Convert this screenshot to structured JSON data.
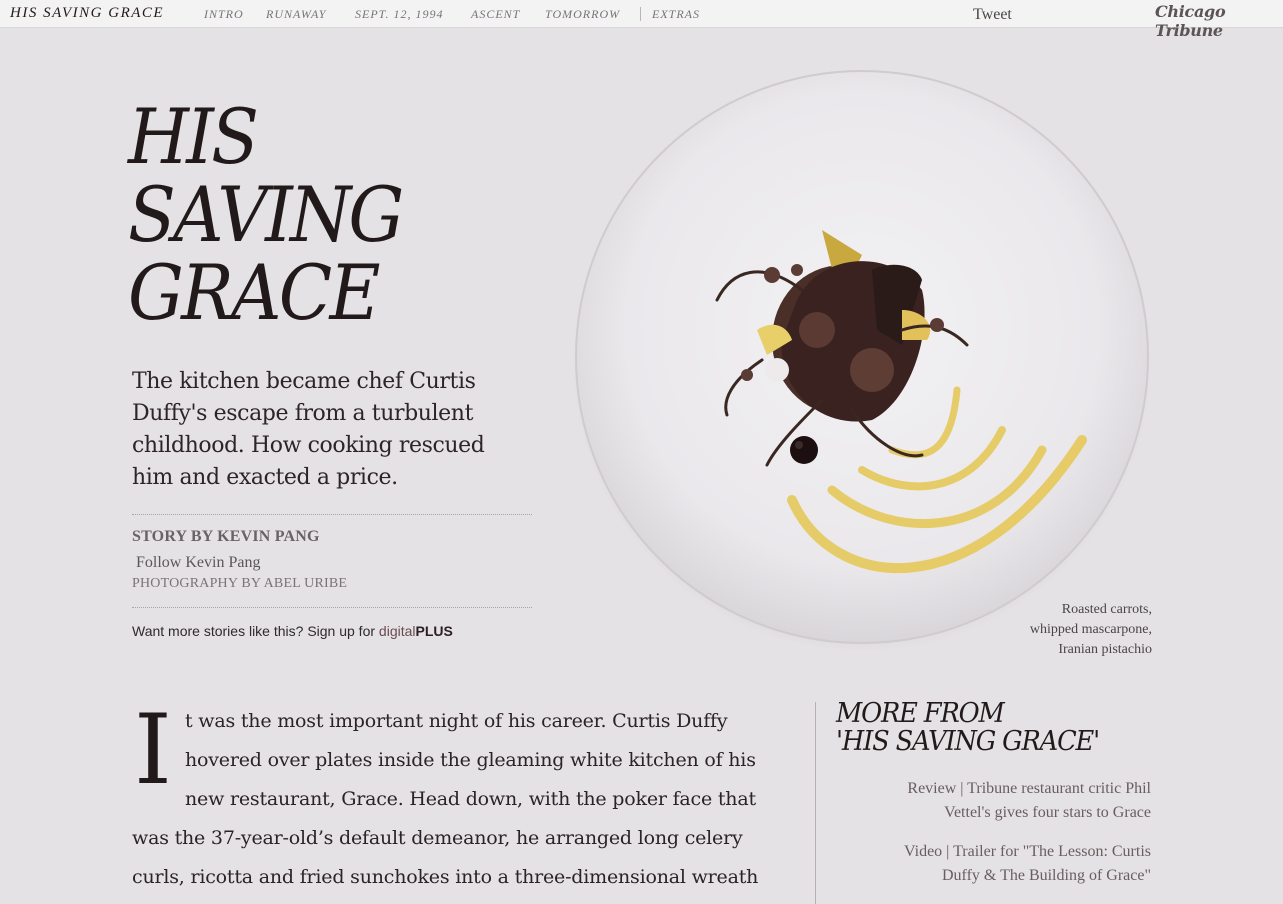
{
  "topnav": {
    "brand": "HIS SAVING GRACE",
    "links": [
      "INTRO",
      "RUNAWAY",
      "SEPT. 12, 1994",
      "ASCENT",
      "TOMORROW",
      "EXTRAS"
    ],
    "tweet": "Tweet",
    "publisher": "Chicago Tribune"
  },
  "hero": {
    "headline": [
      "HIS",
      "SAVING",
      "GRACE"
    ],
    "dek": "The kitchen became chef Curtis Duffy's escape from a turbulent childhood. How cooking rescued him and exacted a price.",
    "byline": "STORY BY KEVIN PANG",
    "follow": "Follow Kevin Pang",
    "photo_credit": "PHOTOGRAPHY BY ABEL URIBE",
    "signup_prefix": "Want more stories like this? Sign up for ",
    "signup_link_a": "digital",
    "signup_link_b": "PLUS",
    "caption": [
      "Roasted carrots,",
      "whipped mascarpone,",
      "Iranian pistachio"
    ]
  },
  "article": {
    "dropcap": "I",
    "lines": [
      "t was the most important night of his career. Curtis Duffy",
      "hovered over plates inside the gleaming white kitchen of his",
      "new restaurant, Grace. Head down, with the poker face that",
      "was the 37-year-old’s default demeanor, he arranged long celery",
      "curls, ricotta and fried sunchokes into a three-dimensional wreath"
    ]
  },
  "sidebar": {
    "title": [
      "MORE FROM",
      "'HIS SAVING GRACE'"
    ],
    "links": [
      [
        "Review | Tribune restaurant critic Phil",
        "Vettel's gives four stars to Grace"
      ],
      [
        "Video | Trailer for \"The Lesson: Curtis",
        "Duffy & The Building of Grace\""
      ]
    ]
  },
  "colors": {
    "background": "#e4e2e4",
    "ink": "#221a1a",
    "sauce": "#e6c95a"
  }
}
